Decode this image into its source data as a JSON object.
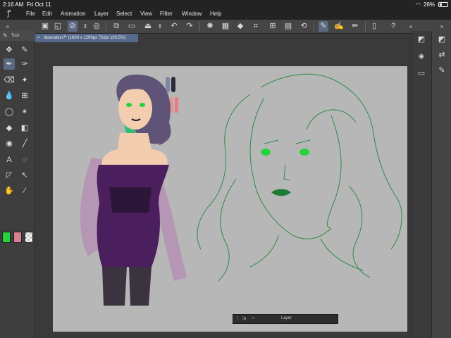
{
  "status": {
    "time": "2:16 AM",
    "date": "Fri Oct 11",
    "battery": "26%"
  },
  "menu": {
    "items": [
      "File",
      "Edit",
      "Animation",
      "Layer",
      "Select",
      "View",
      "Filter",
      "Window",
      "Help"
    ]
  },
  "tab": {
    "label": "Illustration7* (1600 x 1200px 72dpi 100.5%)"
  },
  "tool_panel": {
    "title": "Tool"
  },
  "layer_palette": {
    "title": "Layer"
  },
  "colors": {
    "main": "#27d33a",
    "sub": "#d9808e",
    "accent": "#5b6a82"
  },
  "icons": {
    "toolbar": [
      "new-canvas-icon",
      "select-icon",
      "lasso-select-icon",
      "transform-icon",
      "save-icon",
      "flip-icon",
      "undo-icon",
      "redo-icon",
      "loading-icon",
      "fill-icon",
      "crop-icon",
      "grid-icon",
      "pen-icon",
      "brush-icon",
      "pencil-icon",
      "smartphone-icon",
      "help-icon"
    ],
    "tools": [
      "move-icon",
      "pen-icon",
      "eyedropper-icon",
      "marker-icon",
      "eraser-icon",
      "sparkle-icon",
      "blend-icon",
      "grid-icon",
      "lasso-icon",
      "wand-icon",
      "fill-icon",
      "gradient-icon",
      "figure-icon",
      "line-icon",
      "text-icon",
      "balloon-icon",
      "frame-icon",
      "correct-line-icon",
      "hand-icon",
      "eyedropper-icon"
    ],
    "right_panel": [
      "camera-icon",
      "layers-icon",
      "panel-icon",
      "export-icon",
      "brush-settings-icon"
    ]
  }
}
